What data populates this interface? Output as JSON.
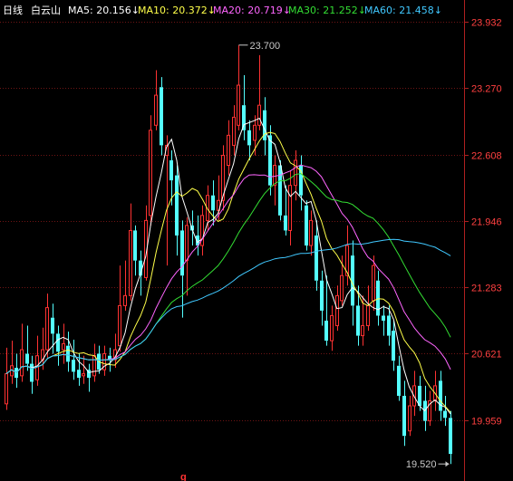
{
  "legend": {
    "period": "日线",
    "stock": "白云山",
    "items": [
      {
        "label": "MA5: 20.156↓",
        "color": "#ffffff"
      },
      {
        "label": "MA10: 20.372↓",
        "color": "#ffff4a"
      },
      {
        "label": "MA20: 20.719↓",
        "color": "#ff66ff"
      },
      {
        "label": "MA30: 21.252↓",
        "color": "#33dd33"
      },
      {
        "label": "MA60: 21.458↓",
        "color": "#40c8ff"
      }
    ]
  },
  "bottom_marker": "g",
  "chart_data": {
    "type": "candlestick",
    "yticks": [
      "23.932",
      "23.270",
      "22.608",
      "21.946",
      "21.283",
      "20.621",
      "19.959"
    ],
    "ylim": [
      19.35,
      24.15
    ],
    "grid": true,
    "annotations": {
      "high": "23.700",
      "low": "19.520"
    },
    "up_color": "#ff3232",
    "down_color": "#54ffff",
    "candles": [
      [
        20.12,
        20.42,
        20.68,
        20.06
      ],
      [
        20.4,
        20.5,
        20.75,
        20.32
      ],
      [
        20.48,
        20.38,
        20.62,
        20.28
      ],
      [
        20.4,
        20.66,
        20.92,
        20.34
      ],
      [
        20.62,
        20.52,
        20.9,
        20.45
      ],
      [
        20.52,
        20.34,
        20.6,
        20.22
      ],
      [
        20.36,
        20.6,
        20.8,
        20.3
      ],
      [
        20.56,
        20.66,
        20.88,
        20.46
      ],
      [
        20.66,
        21.08,
        21.22,
        20.58
      ],
      [
        20.98,
        20.82,
        21.12,
        20.62
      ],
      [
        20.82,
        20.64,
        20.9,
        20.5
      ],
      [
        20.66,
        20.72,
        20.92,
        20.52
      ],
      [
        20.7,
        20.54,
        20.84,
        20.44
      ],
      [
        20.56,
        20.44,
        20.76,
        20.36
      ],
      [
        20.46,
        20.38,
        20.62,
        20.3
      ],
      [
        20.4,
        20.42,
        20.6,
        20.32
      ],
      [
        20.46,
        20.38,
        20.52,
        20.24
      ],
      [
        20.4,
        20.6,
        20.72,
        20.34
      ],
      [
        20.62,
        20.46,
        20.7,
        20.42
      ],
      [
        20.46,
        20.62,
        20.7,
        20.4
      ],
      [
        20.6,
        20.56,
        20.68,
        20.44
      ],
      [
        20.56,
        20.66,
        20.82,
        20.48
      ],
      [
        20.7,
        21.1,
        21.5,
        20.64
      ],
      [
        21.1,
        21.2,
        21.55,
        21.05
      ],
      [
        21.2,
        21.85,
        22.12,
        21.15
      ],
      [
        21.85,
        21.55,
        21.9,
        21.4
      ],
      [
        21.55,
        21.4,
        21.65,
        21.2
      ],
      [
        21.38,
        21.95,
        22.1,
        21.35
      ],
      [
        22.0,
        22.85,
        23.0,
        21.9
      ],
      [
        22.9,
        23.2,
        23.45,
        22.85
      ],
      [
        23.28,
        22.7,
        23.38,
        22.6
      ],
      [
        22.6,
        22.7,
        22.8,
        21.5
      ],
      [
        22.55,
        22.35,
        22.65,
        22.1
      ],
      [
        22.4,
        21.8,
        22.5,
        21.6
      ],
      [
        21.85,
        21.4,
        21.95,
        20.98
      ],
      [
        21.55,
        21.9,
        21.98,
        21.2
      ],
      [
        21.9,
        21.85,
        22.05,
        21.7
      ],
      [
        21.8,
        21.7,
        22.0,
        21.6
      ],
      [
        21.7,
        22.0,
        22.1,
        21.6
      ],
      [
        21.95,
        22.2,
        22.3,
        21.85
      ],
      [
        22.2,
        22.05,
        22.35,
        21.9
      ],
      [
        22.05,
        22.15,
        22.4,
        21.95
      ],
      [
        22.15,
        22.6,
        22.7,
        22.05
      ],
      [
        22.5,
        22.8,
        22.95,
        22.4
      ],
      [
        22.7,
        22.98,
        23.1,
        22.6
      ],
      [
        22.9,
        23.3,
        23.7,
        22.85
      ],
      [
        23.1,
        22.85,
        23.4,
        22.75
      ],
      [
        22.85,
        22.7,
        22.95,
        22.55
      ],
      [
        22.75,
        22.9,
        23.0,
        22.6
      ],
      [
        22.9,
        23.1,
        23.6,
        22.85
      ],
      [
        23.05,
        22.75,
        23.18,
        22.6
      ],
      [
        22.8,
        22.3,
        22.9,
        22.2
      ],
      [
        22.3,
        22.5,
        22.6,
        22.1
      ],
      [
        22.5,
        22.0,
        22.55,
        21.95
      ],
      [
        22.0,
        21.85,
        22.3,
        21.8
      ],
      [
        21.85,
        22.3,
        22.45,
        21.7
      ],
      [
        22.3,
        22.55,
        22.65,
        22.15
      ],
      [
        22.5,
        22.2,
        22.6,
        22.05
      ],
      [
        22.1,
        21.7,
        22.15,
        21.65
      ],
      [
        21.7,
        21.95,
        22.05,
        21.6
      ],
      [
        21.8,
        21.35,
        21.95,
        21.25
      ],
      [
        21.35,
        21.05,
        21.45,
        20.9
      ],
      [
        20.95,
        20.75,
        21.4,
        20.7
      ],
      [
        20.75,
        21.0,
        21.1,
        20.65
      ],
      [
        20.9,
        21.2,
        21.3,
        20.85
      ],
      [
        21.15,
        21.4,
        21.6,
        21.1
      ],
      [
        21.4,
        21.7,
        21.9,
        21.3
      ],
      [
        21.6,
        21.1,
        21.75,
        20.9
      ],
      [
        21.1,
        20.8,
        21.3,
        20.7
      ],
      [
        20.8,
        20.9,
        21.2,
        20.7
      ],
      [
        20.9,
        21.1,
        21.3,
        20.85
      ],
      [
        21.15,
        21.5,
        21.6,
        21.05
      ],
      [
        21.35,
        21.0,
        21.45,
        20.9
      ],
      [
        21.0,
        20.95,
        21.1,
        20.8
      ],
      [
        21.0,
        20.8,
        21.1,
        20.7
      ],
      [
        20.85,
        20.55,
        20.95,
        20.45
      ],
      [
        20.5,
        20.2,
        20.6,
        20.15
      ],
      [
        20.2,
        19.8,
        20.35,
        19.7
      ],
      [
        19.85,
        20.1,
        20.2,
        19.8
      ],
      [
        20.1,
        20.3,
        20.45,
        20.0
      ],
      [
        20.3,
        20.1,
        20.4,
        20.05
      ],
      [
        20.15,
        19.95,
        20.3,
        19.85
      ],
      [
        19.95,
        20.15,
        20.25,
        19.9
      ],
      [
        20.15,
        20.3,
        20.45,
        20.05
      ],
      [
        20.35,
        20.05,
        20.45,
        19.95
      ],
      [
        20.05,
        19.98,
        20.2,
        19.9
      ],
      [
        19.98,
        19.62,
        20.05,
        19.52
      ]
    ],
    "ma_series": [
      {
        "name": "MA5",
        "period": 5,
        "color": "#ffffff"
      },
      {
        "name": "MA10",
        "period": 10,
        "color": "#ffff4a"
      },
      {
        "name": "MA20",
        "period": 20,
        "color": "#ff66ff"
      },
      {
        "name": "MA30",
        "period": 30,
        "color": "#33dd33"
      },
      {
        "name": "MA60",
        "period": 60,
        "color": "#40c8ff"
      }
    ]
  }
}
